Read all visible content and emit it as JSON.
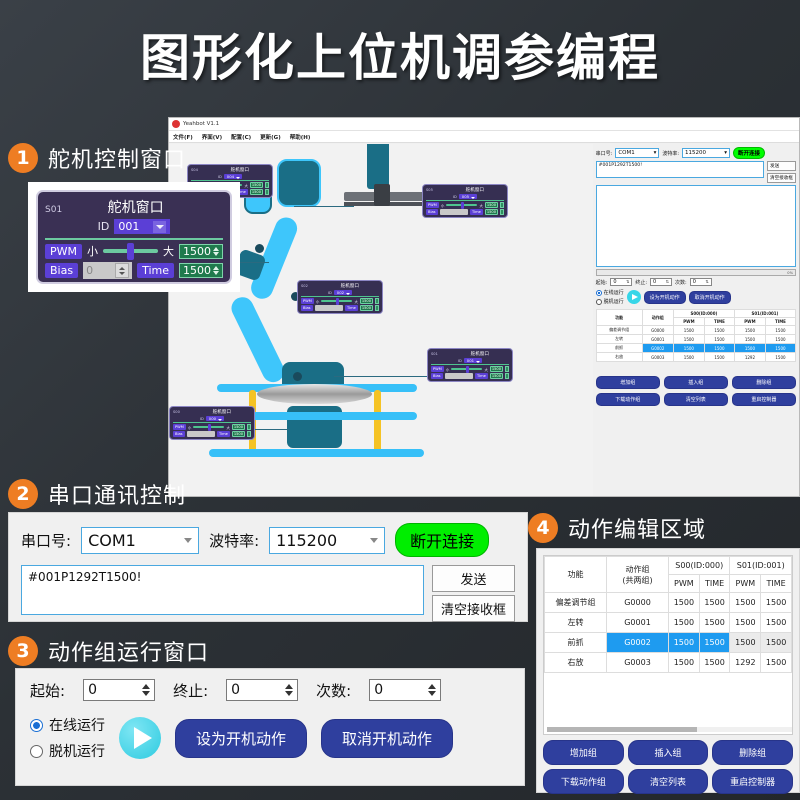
{
  "title": "图形化上位机调参编程",
  "app": {
    "window_title": "Yeahbot V1.1",
    "menu": [
      "文件(F)",
      "界面(V)",
      "配置(C)",
      "更新(G)",
      "帮助(H)"
    ],
    "nodes": [
      {
        "sid": "S04",
        "title": "舵机窗口",
        "id": "004",
        "pwm": "1500",
        "time": "1500",
        "bias": "0"
      },
      {
        "sid": "S05",
        "title": "舵机窗口",
        "id": "005",
        "pwm": "1500",
        "time": "1500",
        "bias": "0"
      },
      {
        "sid": "S02",
        "title": "舵机窗口",
        "id": "002",
        "pwm": "1500",
        "time": "1500",
        "bias": "0"
      },
      {
        "sid": "S01",
        "title": "舵机窗口",
        "id": "001",
        "pwm": "1500",
        "time": "1500",
        "bias": "0"
      },
      {
        "sid": "S00",
        "title": "舵机窗口",
        "id": "000",
        "pwm": "1500",
        "time": "1500",
        "bias": "0"
      }
    ],
    "labels": {
      "pwm": "PWM",
      "bias": "Bias",
      "time": "Time",
      "id": "ID",
      "small": "小",
      "large": "大"
    }
  },
  "serial": {
    "port_label": "串口号:",
    "port_value": "COM1",
    "baud_label": "波特率:",
    "baud_value": "115200",
    "connect_button": "断开连接",
    "send_text": "#001P1292T1500!",
    "send_button": "发送",
    "clear_button": "清空接收框",
    "progress_hint": "0%"
  },
  "runner": {
    "start_label": "起始:",
    "start_value": "0",
    "end_label": "终止:",
    "end_value": "0",
    "count_label": "次数:",
    "count_value": "0",
    "online_label": "在线运行",
    "offline_label": "脱机运行",
    "play_icon": "play-icon",
    "set_boot_button": "设为开机动作",
    "cancel_boot_button": "取消开机动作"
  },
  "table": {
    "headers": {
      "func": "功能",
      "group": "动作组",
      "group_sub": "(共两组)",
      "servo0": "S00(ID:000)",
      "servo1": "S01(ID:001)",
      "pwm": "PWM",
      "time": "TIME"
    },
    "rows": [
      {
        "func": "偏差调节组",
        "group": "G0000",
        "s0pwm": "1500",
        "s0time": "1500",
        "s1pwm": "1500",
        "s1time": "1500",
        "highlight": false
      },
      {
        "func": "左转",
        "group": "G0001",
        "s0pwm": "1500",
        "s0time": "1500",
        "s1pwm": "1500",
        "s1time": "1500",
        "highlight": false
      },
      {
        "func": "前抓",
        "group": "G0002",
        "s0pwm": "1500",
        "s0time": "1500",
        "s1pwm": "1500",
        "s1time": "1500",
        "highlight": true
      },
      {
        "func": "右放",
        "group": "G0003",
        "s0pwm": "1500",
        "s0time": "1500",
        "s1pwm": "1292",
        "s1time": "1500",
        "highlight": false
      }
    ],
    "buttons": [
      "增加组",
      "插入组",
      "删除组",
      "下载动作组",
      "清空列表",
      "重启控制器"
    ]
  },
  "servo_window": {
    "sid": "S01",
    "title": "舵机窗口",
    "id_label": "ID",
    "id_value": "001",
    "pwm_label": "PWM",
    "small_label": "小",
    "large_label": "大",
    "pwm_value": "1500",
    "bias_label": "Bias",
    "bias_value": "0",
    "time_label": "Time",
    "time_value": "1500"
  },
  "callouts": [
    {
      "num": "1",
      "title": "舵机控制窗口"
    },
    {
      "num": "2",
      "title": "串口通讯控制"
    },
    {
      "num": "3",
      "title": "动作组运行窗口"
    },
    {
      "num": "4",
      "title": "动作编辑区域"
    }
  ],
  "colors": {
    "accent_orange": "#ee7d23",
    "blue_button": "#2f3f9e",
    "green_button": "#00ee00",
    "highlight_row": "#1e9bf0",
    "node_purple": "#5b3fd6"
  }
}
